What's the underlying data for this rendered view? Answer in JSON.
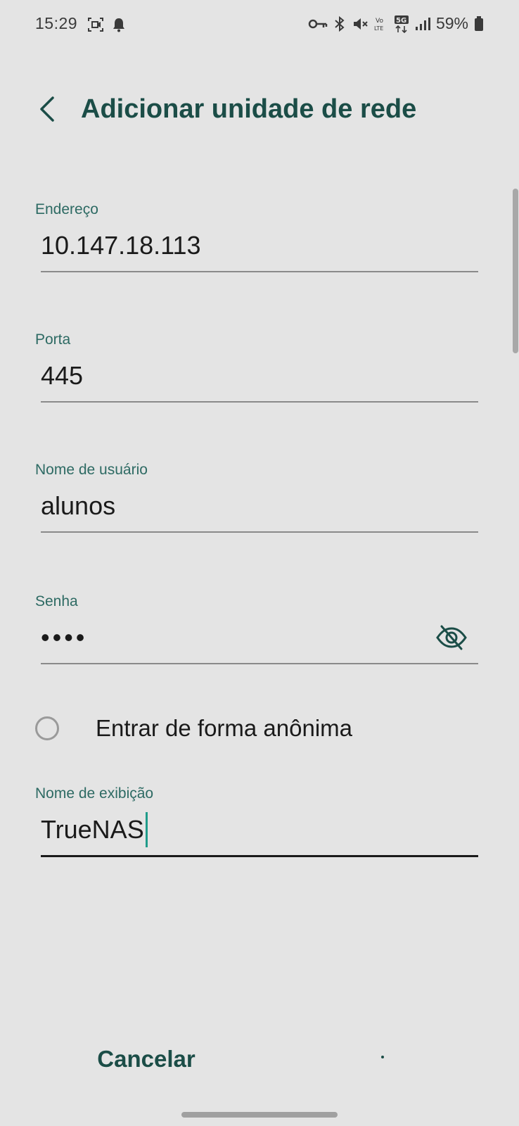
{
  "status_bar": {
    "time": "15:29",
    "battery": "59%",
    "left_icons": [
      "screen-record-icon",
      "notification-bell-icon"
    ],
    "right_icons": [
      "vpn-key-icon",
      "bluetooth-icon",
      "mute-icon",
      "volte-icon",
      "5g-icon",
      "signal-icon",
      "battery-icon"
    ]
  },
  "header": {
    "title": "Adicionar unidade de rede",
    "back_icon": "chevron-left-icon"
  },
  "form": {
    "address": {
      "label": "Endereço",
      "value": "10.147.18.113"
    },
    "port": {
      "label": "Porta",
      "value": "445"
    },
    "username": {
      "label": "Nome de usuário",
      "value": "alunos"
    },
    "password": {
      "label": "Senha",
      "value": "••••",
      "toggle_icon": "eye-off-icon"
    },
    "anonymous": {
      "label": "Entrar de forma anônima",
      "checked": false
    },
    "display_name": {
      "label": "Nome de exibição",
      "value": "TrueNAS"
    }
  },
  "actions": {
    "cancel_label": "Cancelar"
  },
  "colors": {
    "background": "#e4e4e4",
    "accent": "#1b4d47",
    "label": "#2d6a63",
    "caret": "#1f9c8a"
  }
}
